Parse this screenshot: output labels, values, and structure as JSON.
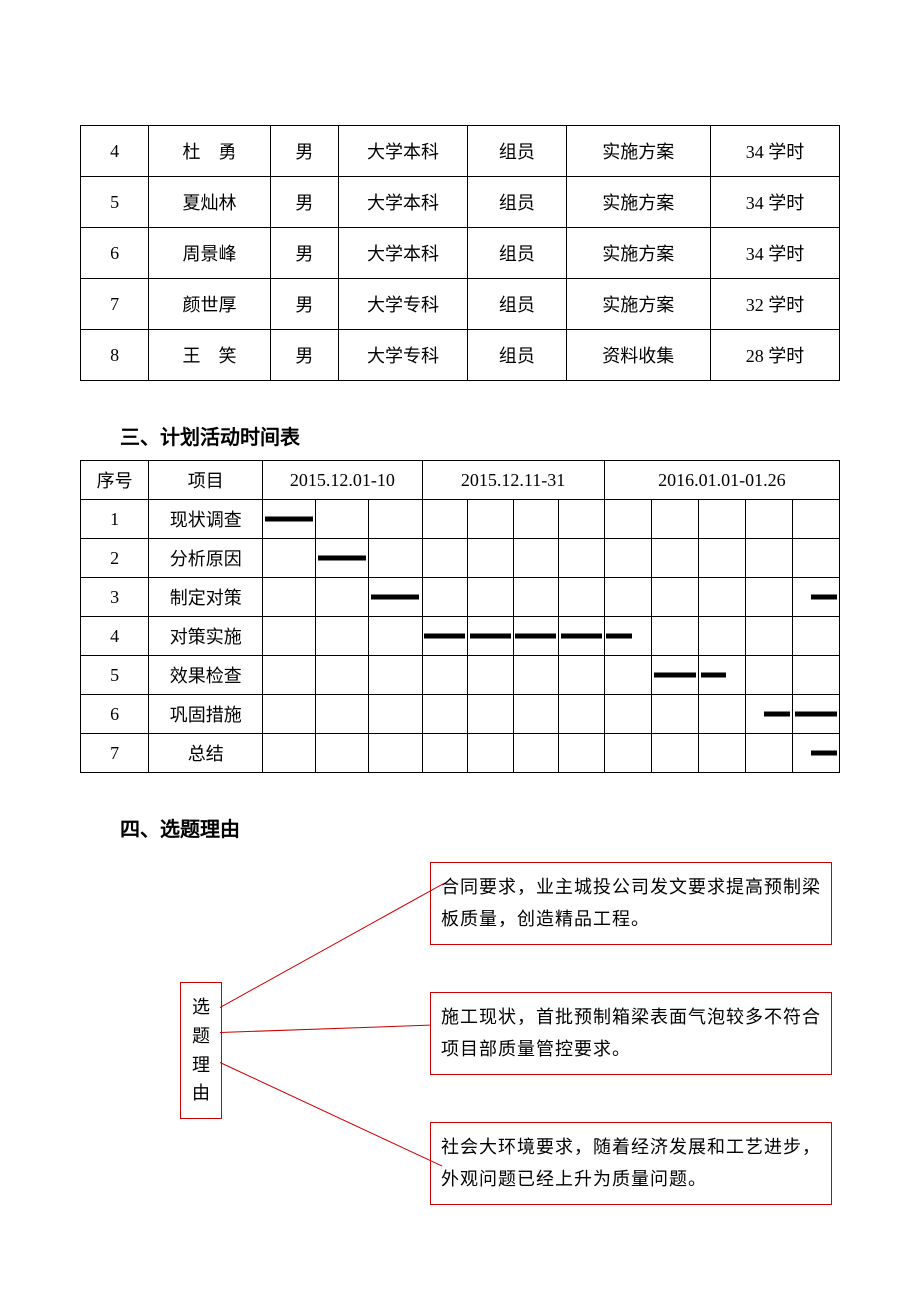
{
  "table1": {
    "rows": [
      {
        "no": "4",
        "name": "杜　勇",
        "gender": "男",
        "edu": "大学本科",
        "role": "组员",
        "task": "实施方案",
        "hours": "34 学时"
      },
      {
        "no": "5",
        "name": "夏灿林",
        "gender": "男",
        "edu": "大学本科",
        "role": "组员",
        "task": "实施方案",
        "hours": "34 学时"
      },
      {
        "no": "6",
        "name": "周景峰",
        "gender": "男",
        "edu": "大学本科",
        "role": "组员",
        "task": "实施方案",
        "hours": "34 学时"
      },
      {
        "no": "7",
        "name": "颜世厚",
        "gender": "男",
        "edu": "大学专科",
        "role": "组员",
        "task": "实施方案",
        "hours": "32 学时"
      },
      {
        "no": "8",
        "name": "王　笑",
        "gender": "男",
        "edu": "大学专科",
        "role": "组员",
        "task": "资料收集",
        "hours": "28 学时"
      }
    ]
  },
  "heading3": "三、计划活动时间表",
  "table2": {
    "head": {
      "no": "序号",
      "item": "项目",
      "p1": "2015.12.01-10",
      "p2": "2015.12.11-31",
      "p3": "2016.01.01-01.26"
    },
    "rows": [
      {
        "no": "1",
        "item": "现状调查"
      },
      {
        "no": "2",
        "item": "分析原因"
      },
      {
        "no": "3",
        "item": "制定对策"
      },
      {
        "no": "4",
        "item": "对策实施"
      },
      {
        "no": "5",
        "item": "效果检查"
      },
      {
        "no": "6",
        "item": "巩固措施"
      },
      {
        "no": "7",
        "item": "总结"
      }
    ]
  },
  "chart_data": {
    "type": "table",
    "title": "计划活动时间表 (Gantt)",
    "columns": [
      "2015.12.01-10 (3 sub)",
      "2015.12.11-31 (4 sub)",
      "2016.01.01-01.26 (5 sub)"
    ],
    "tasks": [
      {
        "name": "现状调查",
        "bars": [
          {
            "col": 1,
            "sub": 1
          }
        ]
      },
      {
        "name": "分析原因",
        "bars": [
          {
            "col": 1,
            "sub": 2
          }
        ]
      },
      {
        "name": "制定对策",
        "bars": [
          {
            "col": 1,
            "sub": 3
          },
          {
            "col": 3,
            "sub": 5
          }
        ]
      },
      {
        "name": "对策实施",
        "bars": [
          {
            "col": 2,
            "sub": 1
          },
          {
            "col": 2,
            "sub": 2
          },
          {
            "col": 2,
            "sub": 3
          },
          {
            "col": 2,
            "sub": 4
          },
          {
            "col": 3,
            "sub": 1
          }
        ]
      },
      {
        "name": "效果检查",
        "bars": [
          {
            "col": 3,
            "sub": 2
          },
          {
            "col": 3,
            "sub": 3
          }
        ]
      },
      {
        "name": "巩固措施",
        "bars": [
          {
            "col": 3,
            "sub": 4
          },
          {
            "col": 3,
            "sub": 5
          }
        ]
      },
      {
        "name": "总结",
        "bars": [
          {
            "col": 3,
            "sub": 5
          }
        ]
      }
    ]
  },
  "heading4": "四、选题理由",
  "diagram": {
    "left": "选\n题\n理\n由",
    "r1": "合同要求，业主城投公司发文要求提高预制梁板质量，创造精品工程。",
    "r2": "施工现状，首批预制箱梁表面气泡较多不符合项目部质量管控要求。",
    "r3": "社会大环境要求，随着经济发展和工艺进步，外观问题已经上升为质量问题。"
  }
}
